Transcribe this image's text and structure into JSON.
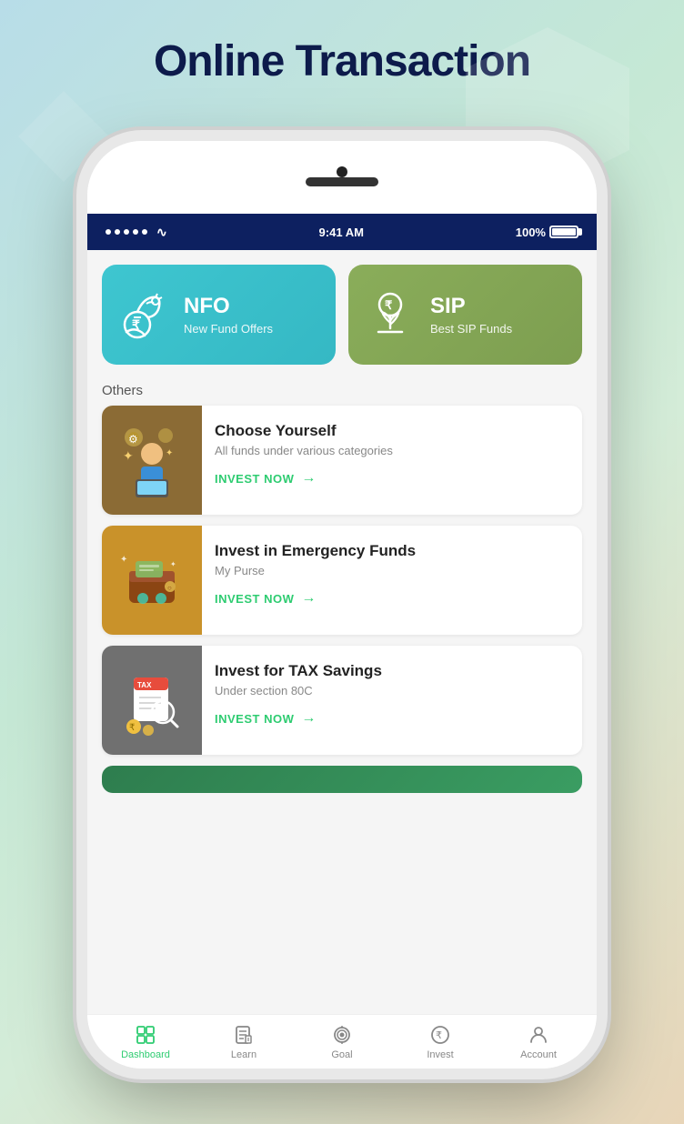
{
  "page": {
    "title": "Online Transaction",
    "background_colors": [
      "#b8dde8",
      "#c5e8d5",
      "#e8d5b8"
    ]
  },
  "status_bar": {
    "time": "9:41 AM",
    "battery_percent": "100%"
  },
  "top_cards": [
    {
      "id": "nfo",
      "title": "NFO",
      "subtitle": "New Fund Offers",
      "bg_color": "#3ec6d0"
    },
    {
      "id": "sip",
      "title": "SIP",
      "subtitle": "Best SIP Funds",
      "bg_color": "#8aad5a"
    }
  ],
  "others_label": "Others",
  "list_items": [
    {
      "id": "choose-yourself",
      "title": "Choose Yourself",
      "subtitle": "All funds under various categories",
      "cta": "INVEST NOW",
      "image_bg": "brown"
    },
    {
      "id": "emergency-funds",
      "title": "Invest in Emergency Funds",
      "subtitle": "My Purse",
      "cta": "INVEST NOW",
      "image_bg": "gold"
    },
    {
      "id": "tax-savings",
      "title": "Invest for TAX Savings",
      "subtitle": "Under section 80C",
      "cta": "INVEST NOW",
      "image_bg": "gray"
    }
  ],
  "bottom_nav": [
    {
      "id": "dashboard",
      "label": "Dashboard",
      "active": true
    },
    {
      "id": "learn",
      "label": "Learn",
      "active": false
    },
    {
      "id": "goal",
      "label": "Goal",
      "active": false
    },
    {
      "id": "invest",
      "label": "Invest",
      "active": false
    },
    {
      "id": "account",
      "label": "Account",
      "active": false
    }
  ]
}
